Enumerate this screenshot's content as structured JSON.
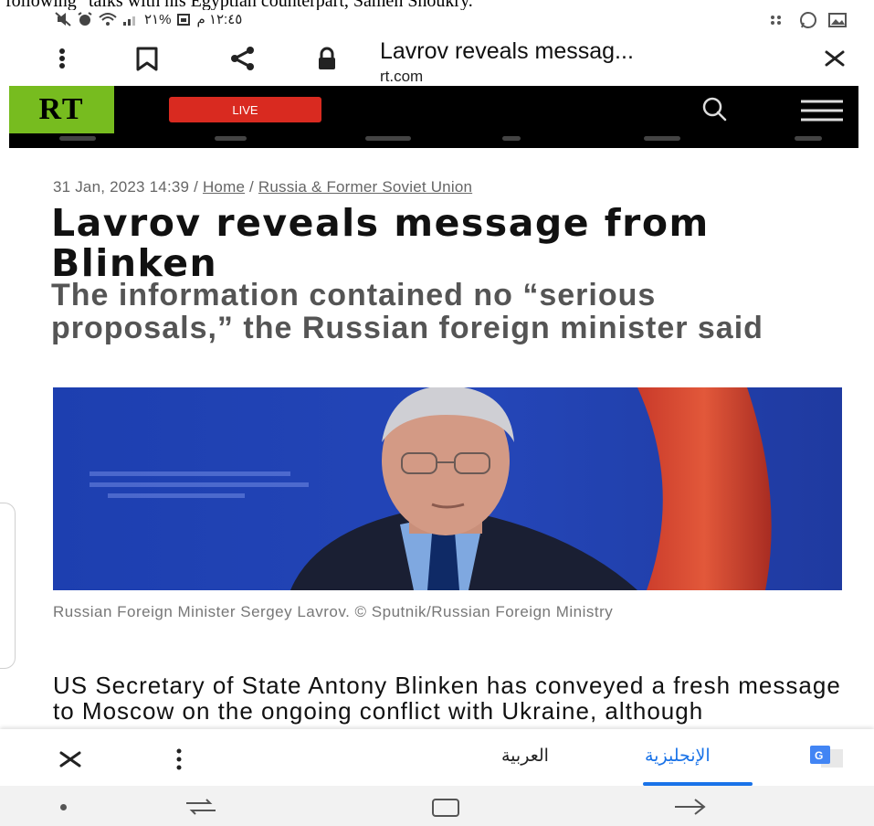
{
  "overlay_caption": "following\" talks with his Egyptian counterpart, Sameh Shoukry.",
  "status_bar": {
    "time": "١٢:٤٥ م",
    "battery": "%٢١"
  },
  "browser": {
    "page_title": "Lavrov reveals messag...",
    "url": "rt.com"
  },
  "site_header": {
    "logo": "RT",
    "live_label": "LIVE"
  },
  "article": {
    "date": "31 Jan, 2023 14:39",
    "separator": " / ",
    "breadcrumb_home": "Home",
    "breadcrumb_section": "Russia & Former Soviet Union",
    "headline": "Lavrov reveals message from Blinken",
    "subheadline": "The information contained no “serious proposals,” the Russian foreign minister said",
    "image_caption": "Russian Foreign Minister Sergey Lavrov. © Sputnik/Russian Foreign Ministry",
    "body_start": "US Secretary of State Antony Blinken has conveyed a fresh message to Moscow on the ongoing conflict with Ukraine, although"
  },
  "translate_bar": {
    "language_arabic": "العربية",
    "language_english": "الإنجليزية"
  },
  "colors": {
    "rt_green": "#77bc1f",
    "live_red": "#d92a20",
    "translate_blue": "#1a73e8"
  }
}
